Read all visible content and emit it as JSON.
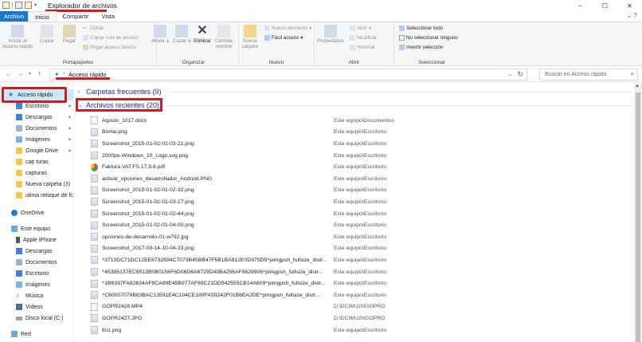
{
  "window": {
    "title": "Explorador de archivos",
    "controls": [
      "–",
      "☐",
      "✕"
    ]
  },
  "tabs": [
    {
      "label": "Archivo"
    },
    {
      "label": "Inicio"
    },
    {
      "label": "Compartir"
    },
    {
      "label": "Vista"
    }
  ],
  "ribbon": {
    "portapapeles": {
      "label": "Portapapeles",
      "anclar": "Anclar al Acceso rápido",
      "copiar": "Copiar",
      "pegar": "Pegar",
      "cortar": "Cortar",
      "copiar_ruta": "Copiar ruta de acceso",
      "pegar_acceso": "Pegar acceso directo"
    },
    "organizar": {
      "label": "Organizar",
      "mover": "Mover a",
      "copiar": "Copiar a",
      "eliminar": "Eliminar",
      "cambiar": "Cambiar nombre"
    },
    "nuevo": {
      "label": "Nuevo",
      "carpeta": "Nueva carpeta",
      "elemento": "Nuevo elemento",
      "facil": "Fácil acceso"
    },
    "abrir": {
      "label": "Abrir",
      "propiedades": "Propiedades",
      "abrir": "Abrir",
      "modificar": "Modificar",
      "historial": "Historial"
    },
    "seleccionar": {
      "label": "Seleccionar",
      "todo": "Seleccionar todo",
      "ninguno": "No seleccionar ninguno",
      "invertir": "Invertir selección"
    }
  },
  "address": {
    "path": "Acceso rápido",
    "search_placeholder": "Buscar en Acceso rápido"
  },
  "nav": {
    "quick_access": "Acceso rápido",
    "items": [
      {
        "label": "Escritorio",
        "pinned": true
      },
      {
        "label": "Descargas",
        "pinned": true
      },
      {
        "label": "Documentos",
        "pinned": true
      },
      {
        "label": "Imágenes",
        "pinned": true
      },
      {
        "label": "Google Drive",
        "pinned": true
      },
      {
        "label": "cap turas",
        "pinned": false
      },
      {
        "label": "capturas",
        "pinned": false
      },
      {
        "label": "Nueva carpeta (3)",
        "pinned": false
      },
      {
        "label": "utima retoque de fc",
        "pinned": false
      }
    ],
    "onedrive": "OneDrive",
    "este_equipo": "Este equipo",
    "pc_items": [
      {
        "label": "Apple iPhone"
      },
      {
        "label": "Descargas"
      },
      {
        "label": "Documentos"
      },
      {
        "label": "Escritorio"
      },
      {
        "label": "Imágenes"
      },
      {
        "label": "Música"
      },
      {
        "label": "Vídeos"
      },
      {
        "label": "Disco local (C:)"
      }
    ],
    "red": "Red"
  },
  "content": {
    "frequent_folders": "Carpetas frecuentes (9)",
    "recent_files": "Archivos recientes (20)",
    "files": [
      {
        "name": "Agosto_1017.docx",
        "location": "Este equipo\\Documentos",
        "kind": "doc"
      },
      {
        "name": "Borrar.png",
        "location": "Este equipo\\Escritorio",
        "kind": "img"
      },
      {
        "name": "Screenshot_2015-01-02-01-03-21.png",
        "location": "Este equipo\\Escritorio",
        "kind": "img"
      },
      {
        "name": "2000px-Windows_10_Logo.svg.png",
        "location": "Este equipo\\Escritorio",
        "kind": "img"
      },
      {
        "name": "Faktura.VAT.FS.17.9.6.pdf",
        "location": "Este equipo\\Escritorio",
        "kind": "pdf"
      },
      {
        "name": "activar_opciones_desarrollador_Android.PNG",
        "location": "Este equipo\\Escritorio",
        "kind": "img"
      },
      {
        "name": "Screenshot_2015-01-02-01-02-32.png",
        "location": "Este equipo\\Escritorio",
        "kind": "img"
      },
      {
        "name": "Screenshot_2015-01-02-01-03-17.png",
        "location": "Este equipo\\Escritorio",
        "kind": "img"
      },
      {
        "name": "Screenshot_2015-01-02-01-02-44.png",
        "location": "Este equipo\\Escritorio",
        "kind": "img"
      },
      {
        "name": "Screenshot_2015-01-02-01-04-00.png",
        "location": "Este equipo\\Escritorio",
        "kind": "img"
      },
      {
        "name": "opciones-de-desarrollo-01-w792.jpg",
        "location": "Este equipo\\Escritorio",
        "kind": "img"
      },
      {
        "name": "Screenshot_2017-09-14-10-04-33.png",
        "location": "Este equipo\\Escritorio",
        "kind": "img"
      },
      {
        "name": "^3710DC71DC12EE6732594C7073B45BB47F5B1BA912E0D975D5^pimgpsh_fullsize_distr...",
        "location": "Este equipo\\Escritorio",
        "kind": "img"
      },
      {
        "name": "^45385137EC8513B0B0156F6D06D6A6729D40B4256AF9829906^pimgpsh_fullsize_distr...",
        "location": "Este equipo\\Escritorio",
        "kind": "img"
      },
      {
        "name": "^1B6337FA82634AF8CA89E45B977AF69C21DD542555CB14A609^pimgpsh_fullsize_distr...",
        "location": "Este equipo\\Escritorio",
        "kind": "img"
      },
      {
        "name": "^C60007079B63BAC13591E4C194CE199FA59242F01B6EA2DE^pimgpsh_fullsize_distr...",
        "location": "Este equipo\\Escritorio",
        "kind": "img"
      },
      {
        "name": "GOPR2428.MP4",
        "location": "D:\\DCIM\\100GOPRO",
        "kind": "doc"
      },
      {
        "name": "GOPR2427.JPG",
        "location": "D:\\DCIM\\100GOPRO",
        "kind": "img"
      },
      {
        "name": "tlo1.png",
        "location": "Este equipo\\Escritorio",
        "kind": "img"
      }
    ]
  },
  "colors": {
    "accent": "#1979ca",
    "highlight_box": "#c8201c",
    "selection": "#cce8ff",
    "group_header": "#1e3287"
  }
}
